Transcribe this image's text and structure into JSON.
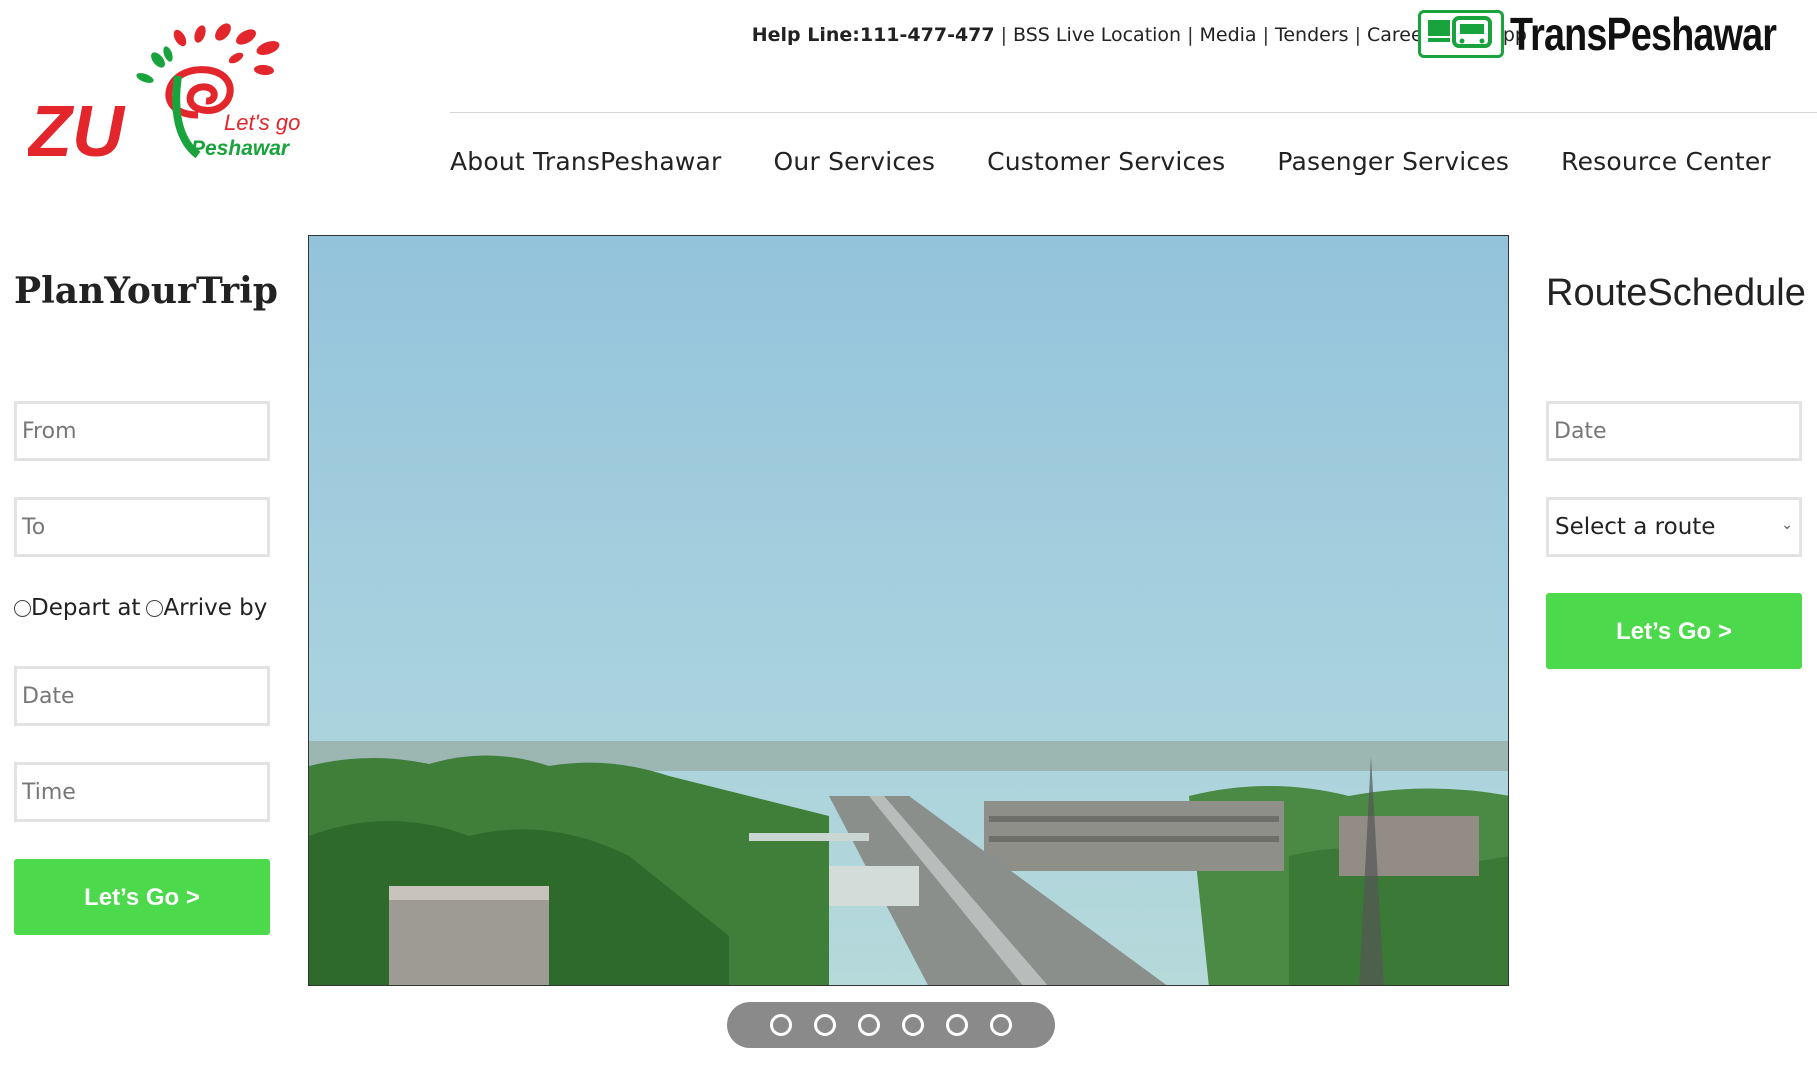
{
  "header": {
    "help_line": "Help Line:111-477-477",
    "top_links": [
      "BSS Live Location",
      "Media",
      "Tenders",
      "Careers",
      "Zu App"
    ],
    "brand_logo_text": "ZU",
    "brand_tagline_1": "Let's go",
    "brand_tagline_2": "Peshawar",
    "transpeshawar_logo_text": "TransPeshawar"
  },
  "nav": {
    "items": [
      "About TransPeshawar",
      "Our Services",
      "Customer Services",
      "Pasenger Services",
      "Resource Center"
    ],
    "search_icon": "search-icon"
  },
  "plan_trip": {
    "title": "PlanYourTrip",
    "from_placeholder": "From",
    "to_placeholder": "To",
    "depart_label": "Depart at",
    "arrive_label": "Arrive by",
    "date_placeholder": "Date",
    "time_placeholder": "Time",
    "button_label": "Let’s Go >"
  },
  "route_schedule": {
    "title": "RouteSchedule",
    "date_placeholder": "Date",
    "route_selected": "Select a route",
    "button_label": "Let’s Go >"
  },
  "slider": {
    "dot_count": 6
  },
  "colors": {
    "accent_green": "#4cd94c",
    "logo_red": "#e3262b",
    "logo_green": "#19a33d"
  }
}
